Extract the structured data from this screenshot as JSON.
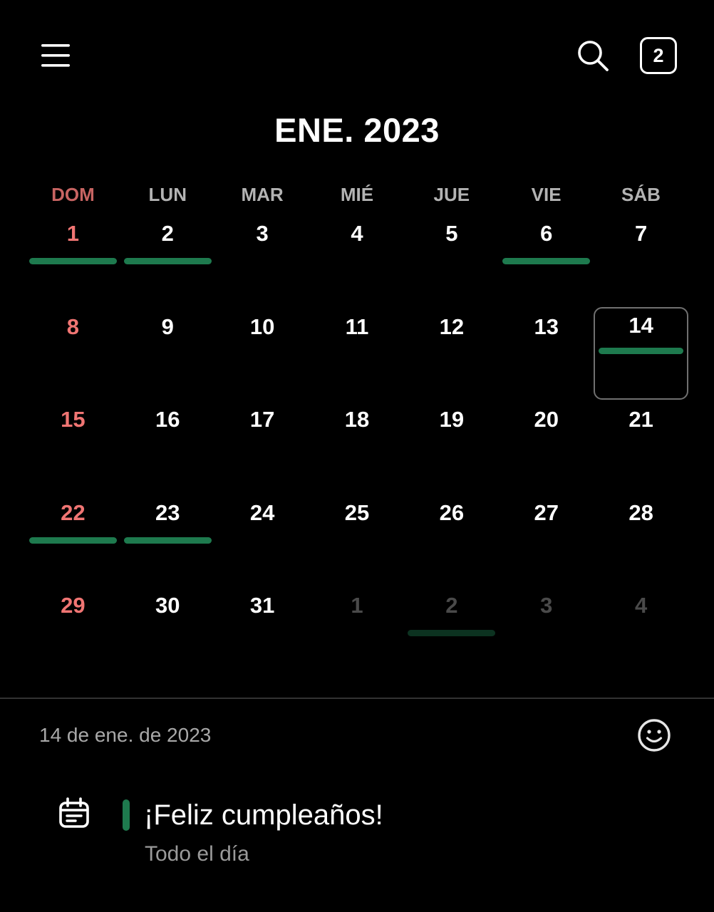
{
  "header": {
    "menu_icon": "hamburger-menu-icon",
    "search_icon": "search-icon",
    "today_badge": "2",
    "month_title": "ENE. 2023"
  },
  "calendar": {
    "weekdays": [
      "DOM",
      "LUN",
      "MAR",
      "MIÉ",
      "JUE",
      "VIE",
      "SÁB"
    ],
    "days": [
      {
        "label": "1",
        "current_month": true,
        "event": true
      },
      {
        "label": "2",
        "current_month": true,
        "event": true
      },
      {
        "label": "3",
        "current_month": true,
        "event": false
      },
      {
        "label": "4",
        "current_month": true,
        "event": false
      },
      {
        "label": "5",
        "current_month": true,
        "event": false
      },
      {
        "label": "6",
        "current_month": true,
        "event": true
      },
      {
        "label": "7",
        "current_month": true,
        "event": false
      },
      {
        "label": "8",
        "current_month": true,
        "event": false
      },
      {
        "label": "9",
        "current_month": true,
        "event": false
      },
      {
        "label": "10",
        "current_month": true,
        "event": false
      },
      {
        "label": "11",
        "current_month": true,
        "event": false
      },
      {
        "label": "12",
        "current_month": true,
        "event": false
      },
      {
        "label": "13",
        "current_month": true,
        "event": false
      },
      {
        "label": "14",
        "current_month": true,
        "event": true,
        "selected": true
      },
      {
        "label": "15",
        "current_month": true,
        "event": false
      },
      {
        "label": "16",
        "current_month": true,
        "event": false
      },
      {
        "label": "17",
        "current_month": true,
        "event": false
      },
      {
        "label": "18",
        "current_month": true,
        "event": false
      },
      {
        "label": "19",
        "current_month": true,
        "event": false
      },
      {
        "label": "20",
        "current_month": true,
        "event": false
      },
      {
        "label": "21",
        "current_month": true,
        "event": false
      },
      {
        "label": "22",
        "current_month": true,
        "event": true
      },
      {
        "label": "23",
        "current_month": true,
        "event": true
      },
      {
        "label": "24",
        "current_month": true,
        "event": false
      },
      {
        "label": "25",
        "current_month": true,
        "event": false
      },
      {
        "label": "26",
        "current_month": true,
        "event": false
      },
      {
        "label": "27",
        "current_month": true,
        "event": false
      },
      {
        "label": "28",
        "current_month": true,
        "event": false
      },
      {
        "label": "29",
        "current_month": true,
        "event": false
      },
      {
        "label": "30",
        "current_month": true,
        "event": false
      },
      {
        "label": "31",
        "current_month": true,
        "event": false
      },
      {
        "label": "1",
        "current_month": false,
        "event": false
      },
      {
        "label": "2",
        "current_month": false,
        "event": true
      },
      {
        "label": "3",
        "current_month": false,
        "event": false
      },
      {
        "label": "4",
        "current_month": false,
        "event": false
      }
    ]
  },
  "selected_day": {
    "date_label": "14 de ene. de 2023",
    "mood_icon": "smiley-icon"
  },
  "events": [
    {
      "title": "¡Feliz cumpleaños!",
      "subtitle": "Todo el día",
      "icon": "calendar-event-icon"
    }
  ],
  "colors": {
    "background": "#000000",
    "sunday": "#f07573",
    "event_green": "#1e7a4e",
    "muted_text": "#a8a8a8"
  }
}
